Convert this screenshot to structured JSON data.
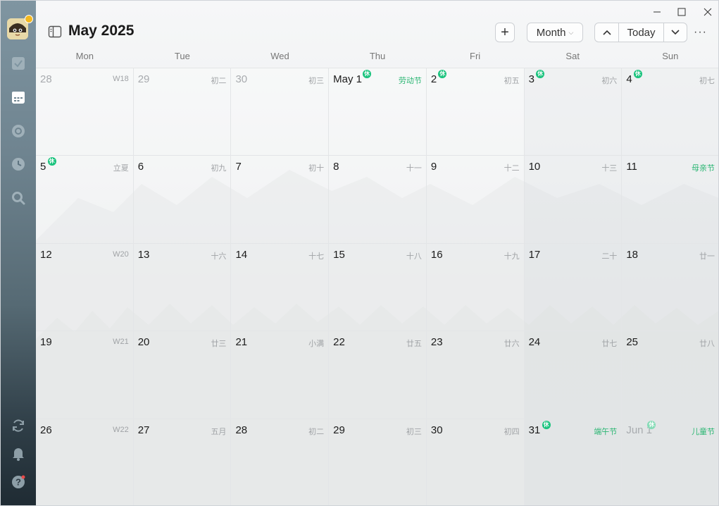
{
  "window": {
    "controls": [
      "minimize",
      "maximize",
      "close"
    ]
  },
  "sidebar": {
    "items": [
      {
        "name": "tasks",
        "icon": "checkbox-icon",
        "active": false
      },
      {
        "name": "calendar",
        "icon": "calendar-icon",
        "active": true
      },
      {
        "name": "focus",
        "icon": "target-icon",
        "active": false
      },
      {
        "name": "habits",
        "icon": "clock-icon",
        "active": false
      },
      {
        "name": "search",
        "icon": "search-icon",
        "active": false
      }
    ],
    "bottom_items": [
      {
        "name": "sync",
        "icon": "sync-icon"
      },
      {
        "name": "notifications",
        "icon": "bell-icon"
      },
      {
        "name": "help",
        "icon": "help-icon"
      }
    ]
  },
  "header": {
    "title": "May 2025",
    "add_label": "+",
    "view_label": "Month",
    "today_label": "Today",
    "more_label": "···"
  },
  "weekdays": [
    "Mon",
    "Tue",
    "Wed",
    "Thu",
    "Fri",
    "Sat",
    "Sun"
  ],
  "weeks": [
    [
      {
        "day": "28",
        "dim": true,
        "right": "W18",
        "right_type": "week"
      },
      {
        "day": "29",
        "dim": true,
        "right": "初二"
      },
      {
        "day": "30",
        "dim": true,
        "right": "初三"
      },
      {
        "day": "May 1",
        "badge": "休",
        "right": "劳动节",
        "holiday": true
      },
      {
        "day": "2",
        "badge": "休",
        "right": "初五"
      },
      {
        "day": "3",
        "badge": "休",
        "right": "初六",
        "weekend": true
      },
      {
        "day": "4",
        "badge": "休",
        "right": "初七",
        "weekend": true
      }
    ],
    [
      {
        "day": "5",
        "badge": "休",
        "right": "立夏"
      },
      {
        "day": "6",
        "right": "初九"
      },
      {
        "day": "7",
        "right": "初十"
      },
      {
        "day": "8",
        "right": "十一"
      },
      {
        "day": "9",
        "right": "十二"
      },
      {
        "day": "10",
        "right": "十三",
        "weekend": true
      },
      {
        "day": "11",
        "right": "母亲节",
        "holiday": true,
        "weekend": true
      }
    ],
    [
      {
        "day": "12",
        "right": "W20",
        "right_type": "week"
      },
      {
        "day": "13",
        "right": "十六"
      },
      {
        "day": "14",
        "right": "十七"
      },
      {
        "day": "15",
        "right": "十八"
      },
      {
        "day": "16",
        "right": "十九"
      },
      {
        "day": "17",
        "right": "二十",
        "weekend": true
      },
      {
        "day": "18",
        "right": "廿一",
        "weekend": true
      }
    ],
    [
      {
        "day": "19",
        "right": "W21",
        "right_type": "week"
      },
      {
        "day": "20",
        "right": "廿三"
      },
      {
        "day": "21",
        "right": "小满"
      },
      {
        "day": "22",
        "right": "廿五"
      },
      {
        "day": "23",
        "right": "廿六"
      },
      {
        "day": "24",
        "right": "廿七",
        "weekend": true
      },
      {
        "day": "25",
        "right": "廿八",
        "weekend": true
      }
    ],
    [
      {
        "day": "26",
        "right": "W22",
        "right_type": "week"
      },
      {
        "day": "27",
        "right": "五月"
      },
      {
        "day": "28",
        "right": "初二"
      },
      {
        "day": "29",
        "right": "初三"
      },
      {
        "day": "30",
        "right": "初四"
      },
      {
        "day": "31",
        "badge": "休",
        "right": "端午节",
        "holiday": true,
        "weekend": true
      },
      {
        "day": "Jun 1",
        "dim": true,
        "badge": "休",
        "right": "儿童节",
        "holiday": true,
        "weekend": true
      }
    ]
  ],
  "colors": {
    "holiday_green": "#2bb673",
    "badge_green": "#19c37d",
    "sidebar_top": "#7f95a1",
    "sidebar_bottom": "#1f2b33"
  }
}
